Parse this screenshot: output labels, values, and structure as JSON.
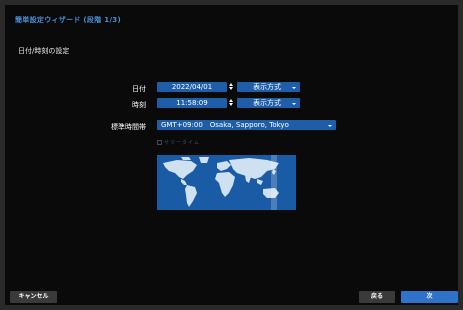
{
  "window": {
    "title": "簡単設定ウィザード (段階 1/3)"
  },
  "section": {
    "title": "日付/時刻の設定"
  },
  "date": {
    "label": "日付",
    "value": "2022/04/01",
    "format_label": "表示方式"
  },
  "time": {
    "label": "時刻",
    "value": "11:58:09",
    "format_label": "表示方式"
  },
  "timezone": {
    "label": "標準時間帯",
    "value": "GMT+09:00　Osaka, Sapporo, Tokyo"
  },
  "dst": {
    "label": "サマータイム",
    "checked": false
  },
  "footer": {
    "cancel_label": "キャンセル",
    "back_label": "戻る",
    "next_label": "次"
  },
  "colors": {
    "accent": "#1e5ea8",
    "title": "#4a8fd6",
    "map_water": "#1a5ba5",
    "map_land": "#cfe0f0"
  },
  "icons": {
    "spin": "spinner-arrows-icon",
    "dropdown": "chevron-down-icon",
    "map": "world-map"
  }
}
